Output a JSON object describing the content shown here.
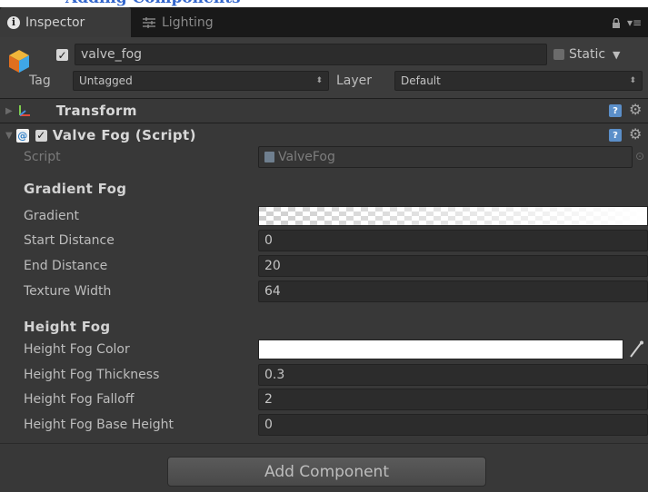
{
  "window_title": "Adding Components",
  "tabs": [
    {
      "label": "Inspector",
      "icon": "info-icon",
      "active": true
    },
    {
      "label": "Lighting",
      "icon": "lighting-icon",
      "active": false
    }
  ],
  "gameobject": {
    "name": "valve_fog",
    "active": true,
    "static_label": "Static",
    "tag_label": "Tag",
    "tag_value": "Untagged",
    "layer_label": "Layer",
    "layer_value": "Default"
  },
  "components": {
    "transform": {
      "title": "Transform"
    },
    "valve_fog": {
      "title": "Valve Fog (Script)",
      "enabled": true,
      "script_label": "Script",
      "script_value": "ValveFog"
    }
  },
  "gradient_fog": {
    "header": "Gradient Fog",
    "gradient_label": "Gradient",
    "start_distance_label": "Start Distance",
    "start_distance": "0",
    "end_distance_label": "End Distance",
    "end_distance": "20",
    "texture_width_label": "Texture Width",
    "texture_width": "64"
  },
  "height_fog": {
    "header": "Height Fog",
    "color_label": "Height Fog Color",
    "color": "#ffffff",
    "thickness_label": "Height Fog Thickness",
    "thickness": "0.3",
    "falloff_label": "Height Fog Falloff",
    "falloff": "2",
    "base_height_label": "Height Fog Base Height",
    "base_height": "0"
  },
  "add_component_label": "Add Component",
  "colors": {
    "panel_bg": "#383838",
    "tab_bar": "#191919",
    "field_bg": "#2c2c2c",
    "help_icon": "#5b8fc9"
  }
}
